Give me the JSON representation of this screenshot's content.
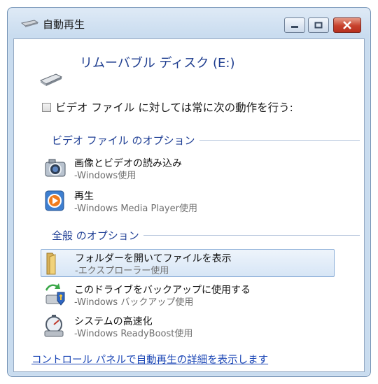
{
  "window": {
    "title": "自動再生",
    "minimize_label": "",
    "maximize_label": "",
    "close_label": ""
  },
  "drive": {
    "name": "リムーバブル ディスク (E:)"
  },
  "always_do": {
    "label": "ビデオ ファイル に対しては常に次の動作を行う:"
  },
  "video_options": {
    "heading": "ビデオ ファイル のオプション",
    "items": [
      {
        "title": "画像とビデオの読み込み",
        "subtitle": "-Windows使用",
        "icon": "camera-icon"
      },
      {
        "title": "再生",
        "subtitle": "-Windows Media Player使用",
        "icon": "media-player-icon"
      }
    ]
  },
  "general_options": {
    "heading": "全般 のオプション",
    "items": [
      {
        "title": "フォルダーを開いてファイルを表示",
        "subtitle": "-エクスプローラー使用",
        "icon": "folder-icon",
        "selected": true
      },
      {
        "title": "このドライブをバックアップに使用する",
        "subtitle": "-Windows バックアップ使用",
        "icon": "backup-icon"
      },
      {
        "title": "システムの高速化",
        "subtitle": "-Windows ReadyBoost使用",
        "icon": "readyboost-icon"
      }
    ]
  },
  "footer": {
    "link": "コントロール パネルで自動再生の詳細を表示します"
  },
  "colors": {
    "accent_text": "#1e3d8f",
    "link": "#1c47b6",
    "close_button": "#c7412c"
  }
}
